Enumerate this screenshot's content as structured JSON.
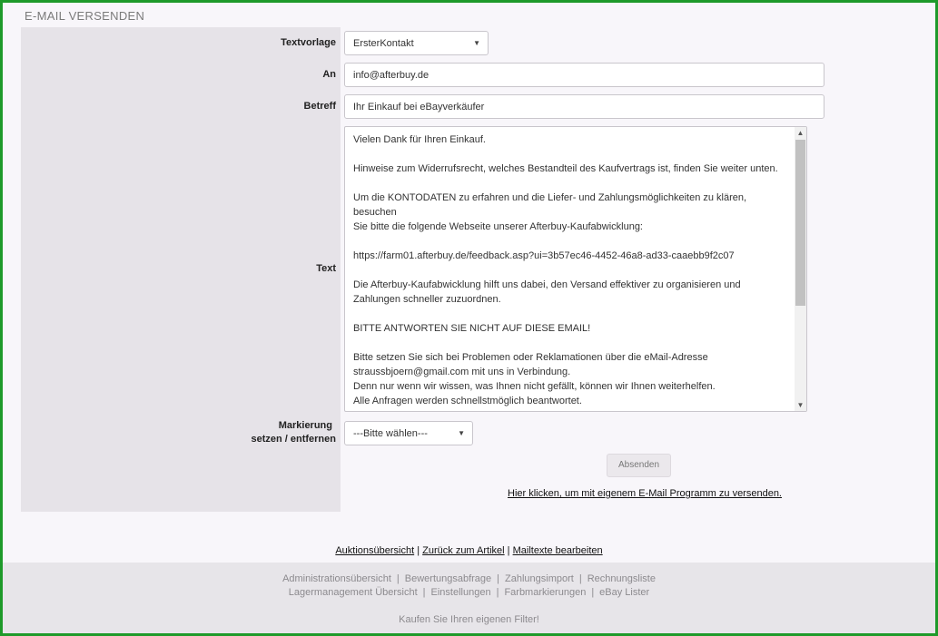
{
  "page": {
    "title": "E-MAIL VERSENDEN"
  },
  "form": {
    "template": {
      "label": "Textvorlage",
      "value": "ErsterKontakt"
    },
    "to": {
      "label": "An",
      "value": "info@afterbuy.de"
    },
    "subject": {
      "label": "Betreff",
      "value": "Ihr Einkauf bei eBayverkäufer"
    },
    "text": {
      "label": "Text",
      "lines": [
        "Vielen Dank für Ihren Einkauf.",
        "",
        "Hinweise zum Widerrufsrecht, welches Bestandteil des Kaufvertrags ist, finden Sie weiter unten.",
        "",
        "Um die KONTODATEN zu erfahren und die Liefer- und Zahlungsmöglichkeiten zu klären, besuchen",
        "Sie bitte die folgende Webseite unserer Afterbuy-Kaufabwicklung:",
        "",
        "https://farm01.afterbuy.de/feedback.asp?ui=3b57ec46-4452-46a8-ad33-caaebb9f2c07",
        "",
        "Die Afterbuy-Kaufabwicklung hilft uns dabei, den Versand effektiver zu organisieren und",
        "Zahlungen schneller zuzuordnen.",
        "",
        "BITTE ANTWORTEN SIE NICHT AUF DIESE EMAIL!",
        "",
        "Bitte setzen Sie sich bei Problemen oder Reklamationen über die eMail-Adresse",
        "straussbjoern@gmail.com mit uns in Verbindung.",
        "Denn nur wenn wir wissen, was Ihnen nicht gefällt, können wir Ihnen weiterhelfen.",
        "Alle Anfragen werden schnellstmöglich beantwortet."
      ]
    },
    "marker": {
      "label_line1": "Markierung",
      "label_line2": "setzen / entfernen",
      "value": "---Bitte wählen---"
    },
    "send_button": "Absenden",
    "mail_program_link": "Hier klicken, um mit eigenem E-Mail Programm zu versenden."
  },
  "bottom_links": {
    "auction": "Auktionsübersicht",
    "back": "Zurück zum Artikel",
    "edit": "Mailtexte bearbeiten"
  },
  "footer": {
    "row1": [
      "Administrationsübersicht",
      "Bewertungsabfrage",
      "Zahlungsimport",
      "Rechnungsliste"
    ],
    "row2": [
      "Lagermanagement Übersicht",
      "Einstellungen",
      "Farbmarkierungen",
      "eBay Lister"
    ],
    "tagline": "Kaufen Sie Ihren eigenen Filter!"
  },
  "colors": {
    "frame": "#1e9a2a",
    "label_panel": "#e6e3e8",
    "footer": "#e7e5e9"
  }
}
